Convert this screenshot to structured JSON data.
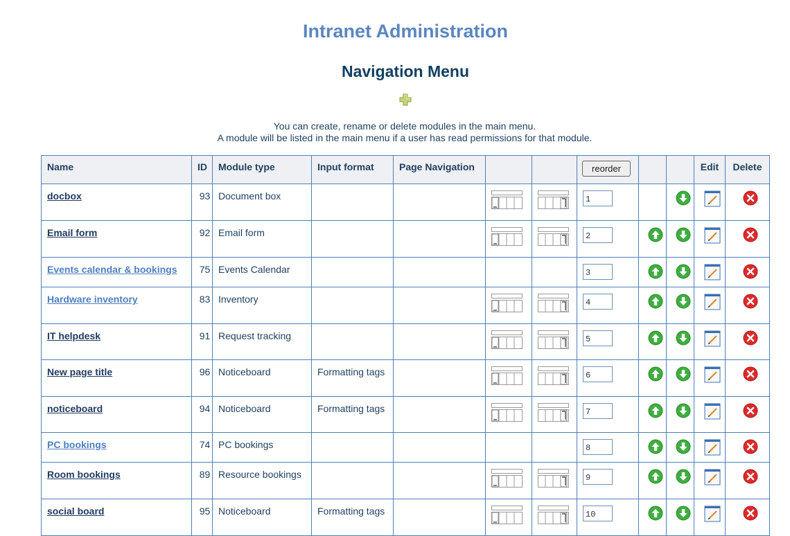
{
  "header": {
    "app_title": "Intranet Administration",
    "page_title": "Navigation Menu",
    "add_icon": "plus-icon",
    "intro_line1": "You can create, rename or delete modules in the main menu.",
    "intro_line2": "A module will be listed in the main menu if a user has read permissions for that module."
  },
  "table": {
    "columns": {
      "name": "Name",
      "id": "ID",
      "module_type": "Module type",
      "input_format": "Input format",
      "page_navigation": "Page Navigation",
      "edit": "Edit",
      "delete": "Delete"
    },
    "reorder_label": "reorder",
    "rows": [
      {
        "name": "docbox",
        "id": "93",
        "type": "Document box",
        "format": "",
        "order": "1",
        "layout": true,
        "up": false,
        "style": "dark"
      },
      {
        "name": "Email form",
        "id": "92",
        "type": "Email form",
        "format": "",
        "order": "2",
        "layout": true,
        "up": true,
        "style": "dark"
      },
      {
        "name": "Events calendar & bookings",
        "id": "75",
        "type": "Events Calendar",
        "format": "",
        "order": "3",
        "layout": false,
        "up": true,
        "style": "light"
      },
      {
        "name": "Hardware inventory",
        "id": "83",
        "type": "Inventory",
        "format": "",
        "order": "4",
        "layout": true,
        "up": true,
        "style": "light"
      },
      {
        "name": "IT helpdesk",
        "id": "91",
        "type": "Request tracking",
        "format": "",
        "order": "5",
        "layout": true,
        "up": true,
        "style": "dark"
      },
      {
        "name": "New page title",
        "id": "96",
        "type": "Noticeboard",
        "format": "Formatting tags",
        "order": "6",
        "layout": true,
        "up": true,
        "style": "dark"
      },
      {
        "name": "noticeboard",
        "id": "94",
        "type": "Noticeboard",
        "format": "Formatting tags",
        "order": "7",
        "layout": true,
        "up": true,
        "style": "dark"
      },
      {
        "name": "PC bookings",
        "id": "74",
        "type": "PC bookings",
        "format": "",
        "order": "8",
        "layout": false,
        "up": true,
        "style": "light"
      },
      {
        "name": "Room bookings",
        "id": "89",
        "type": "Resource bookings",
        "format": "",
        "order": "9",
        "layout": true,
        "up": true,
        "style": "dark"
      },
      {
        "name": "social board",
        "id": "95",
        "type": "Noticeboard",
        "format": "Formatting tags",
        "order": "10",
        "layout": true,
        "up": true,
        "style": "dark"
      }
    ]
  },
  "icons": {
    "layout_left": "layout-left-icon",
    "layout_right": "layout-right-icon",
    "move_up": "arrow-up-icon",
    "move_down": "arrow-down-icon",
    "edit": "edit-icon",
    "delete": "delete-icon"
  },
  "colors": {
    "app_title": "#5b86c0",
    "page_title": "#123f62",
    "table_border": "#4f7fb5",
    "header_bg": "#eef0f4",
    "link_dark": "#1f3a5f",
    "link_light": "#4f7fc0",
    "arrow_green": "#3fae3f",
    "delete_red": "#dd2a2a"
  }
}
